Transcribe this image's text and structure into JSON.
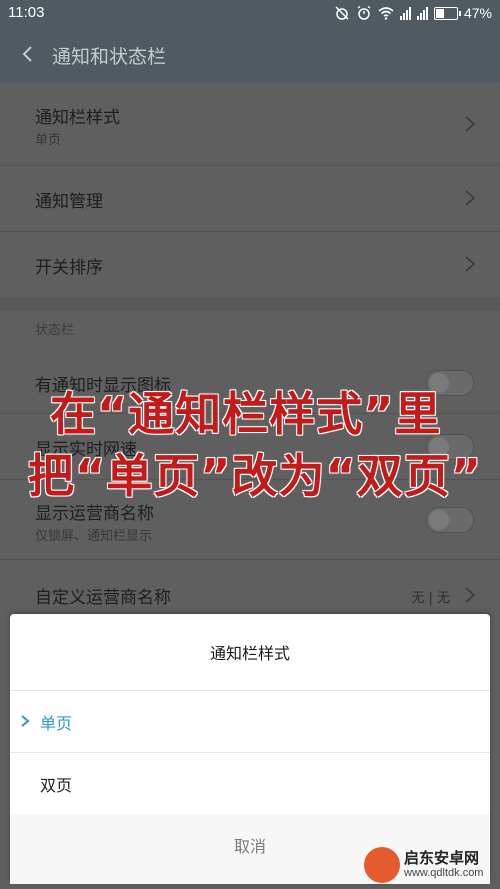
{
  "status_bar": {
    "time": "11:03",
    "battery": "47%",
    "battery_level": 0.47,
    "icons": [
      "alarm-off-icon",
      "alarm-icon",
      "wifi-icon",
      "signal-icon",
      "signal-icon",
      "battery-icon"
    ]
  },
  "header": {
    "title": "通知和状态栏",
    "back_icon": "back-arrow-icon"
  },
  "settings": {
    "notification_style": {
      "label": "通知栏样式",
      "value": "单页"
    },
    "notification_manage": {
      "label": "通知管理"
    },
    "switch_order": {
      "label": "开关排序"
    },
    "status_bar_section": "状态栏",
    "show_icon": {
      "label": "有通知时显示图标"
    },
    "show_speed": {
      "label": "显示实时网速"
    },
    "show_carrier": {
      "label": "显示运营商名称",
      "sub": "仅锁屏、通知栏显示"
    },
    "custom_carrier": {
      "label": "自定义运营商名称",
      "value": "无 | 无"
    }
  },
  "annotation": {
    "line1": "在“通知栏样式”里",
    "line2": "把“单页”改为“双页”",
    "color": "#c31a1a"
  },
  "dialog": {
    "title": "通知栏样式",
    "options": [
      {
        "label": "单页",
        "selected": true
      },
      {
        "label": "双页",
        "selected": false
      }
    ],
    "cancel": "取消",
    "accent": "#2d98cf"
  },
  "watermark": {
    "name": "启东安卓网",
    "url": "www.qdltdk.com"
  }
}
